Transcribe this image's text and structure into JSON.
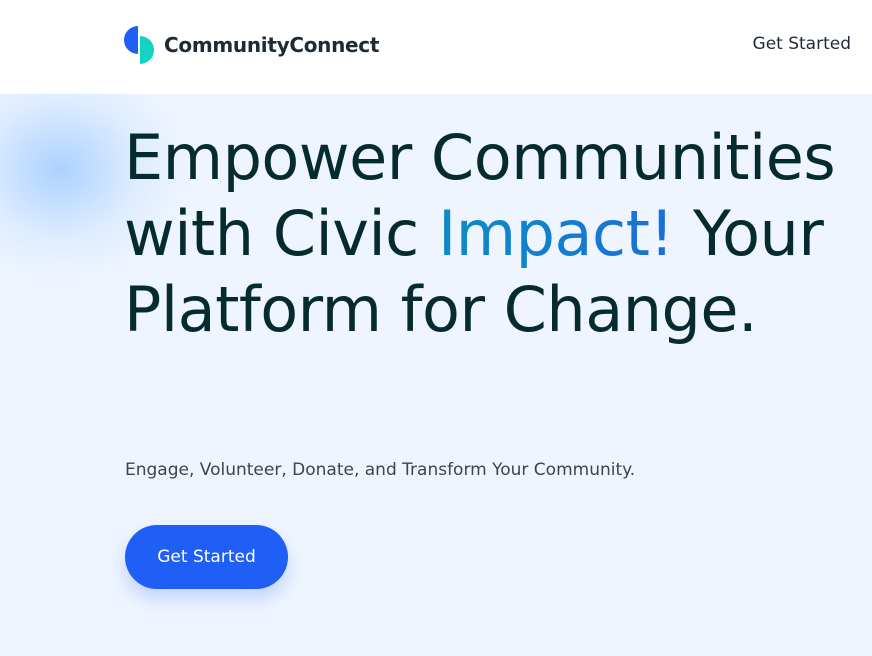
{
  "header": {
    "brand": "CommunityConnect",
    "nav_cta": "Get Started"
  },
  "hero": {
    "headline_before": "Empower Communities with Civic ",
    "headline_accent": "Impact!",
    "headline_after": " Your Platform for Change.",
    "subline": "Engage, Volunteer, Donate, and Transform Your Community.",
    "cta_label": "Get Started"
  },
  "colors": {
    "brand_blue": "#1f5ff5",
    "brand_teal": "#12d3c4",
    "headline": "#062b2e",
    "accent_start": "#0d8cc4",
    "accent_end": "#1a6fd8",
    "hero_bg": "#eff5ff"
  },
  "icons": {
    "logo": "logo-icon"
  }
}
